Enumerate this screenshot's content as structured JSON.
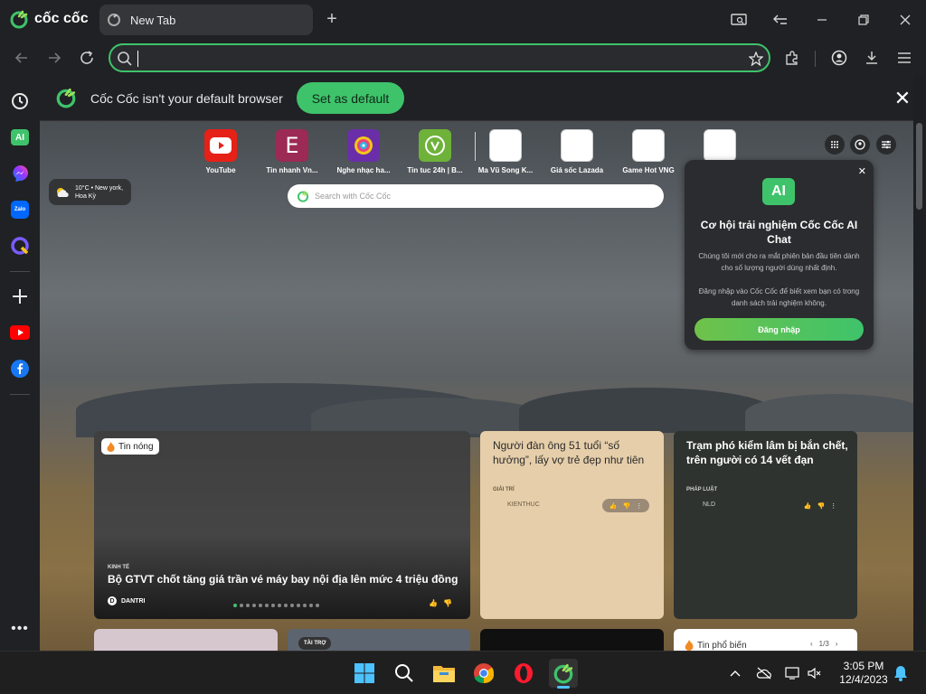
{
  "browser": {
    "brand": "cốc cốc",
    "tab_title": "New Tab",
    "address_value": "",
    "address_placeholder": ""
  },
  "infobar": {
    "message": "Cốc Cốc isn't your default browser",
    "button": "Set as default"
  },
  "speed_dial": [
    {
      "label": "YouTube",
      "icon": "youtube-icon",
      "color": "#e62117"
    },
    {
      "label": "Tin nhanh Vn...",
      "icon": "e-icon",
      "color": "#9b2a54"
    },
    {
      "label": "Nghe nhạc ha...",
      "icon": "music-disc-icon",
      "color": "#6a2fa8"
    },
    {
      "label": "Tin tuc 24h | B...",
      "icon": "clock-v-icon",
      "color": "#6eb23a"
    },
    {
      "label": "Ma Vũ Song K...",
      "icon": "blank-page-icon",
      "color": "#ffffff"
    },
    {
      "label": "Giá sốc Lazada",
      "icon": "blank-page-icon",
      "color": "#ffffff"
    },
    {
      "label": "Game Hot VNG",
      "icon": "blank-page-icon",
      "color": "#ffffff"
    },
    {
      "label": "",
      "icon": "blank-page-icon",
      "color": "#ffffff"
    }
  ],
  "weather": {
    "text": "10°C • New york, Hoa Kỳ"
  },
  "search": {
    "placeholder": "Search with Cốc Cốc"
  },
  "ai_popup": {
    "badge": "AI",
    "title": "Cơ hội trải nghiệm Cốc Cốc AI Chat",
    "desc1": "Chúng tôi mới cho ra mắt phiên bản đầu tiên dành cho số lượng người dùng nhất định.",
    "desc2": "Đăng nhập vào Cốc Cốc để biết xem bạn có trong danh sách trải nghiệm không.",
    "button": "Đăng nhập"
  },
  "news": {
    "main": {
      "badge": "Tin nóng",
      "category": "KINH TẾ",
      "headline": "Bộ GTVT chốt tăng giá trần vé máy bay nội địa lên mức 4 triệu đồng",
      "source": "DANTRI",
      "source_initial": "D",
      "slides": 14,
      "active_slide": 1
    },
    "card_b": {
      "title": "Người đàn ông 51 tuổi “số hưởng”, lấy vợ trẻ đẹp như tiên",
      "category": "GIẢI TRÍ",
      "source": "KIENTHUC"
    },
    "card_c": {
      "title": "Trạm phó kiểm lâm bị bắn chết, trên người có 14 vết đạn",
      "category": "PHÁP LUẬT",
      "source": "NLD"
    },
    "card_e_tag": "TÀI TRỢ",
    "card_g": {
      "label": "Tin phổ biến",
      "pager": "1/3"
    }
  },
  "taskbar": {
    "time": "3:05 PM",
    "date": "12/4/2023"
  }
}
